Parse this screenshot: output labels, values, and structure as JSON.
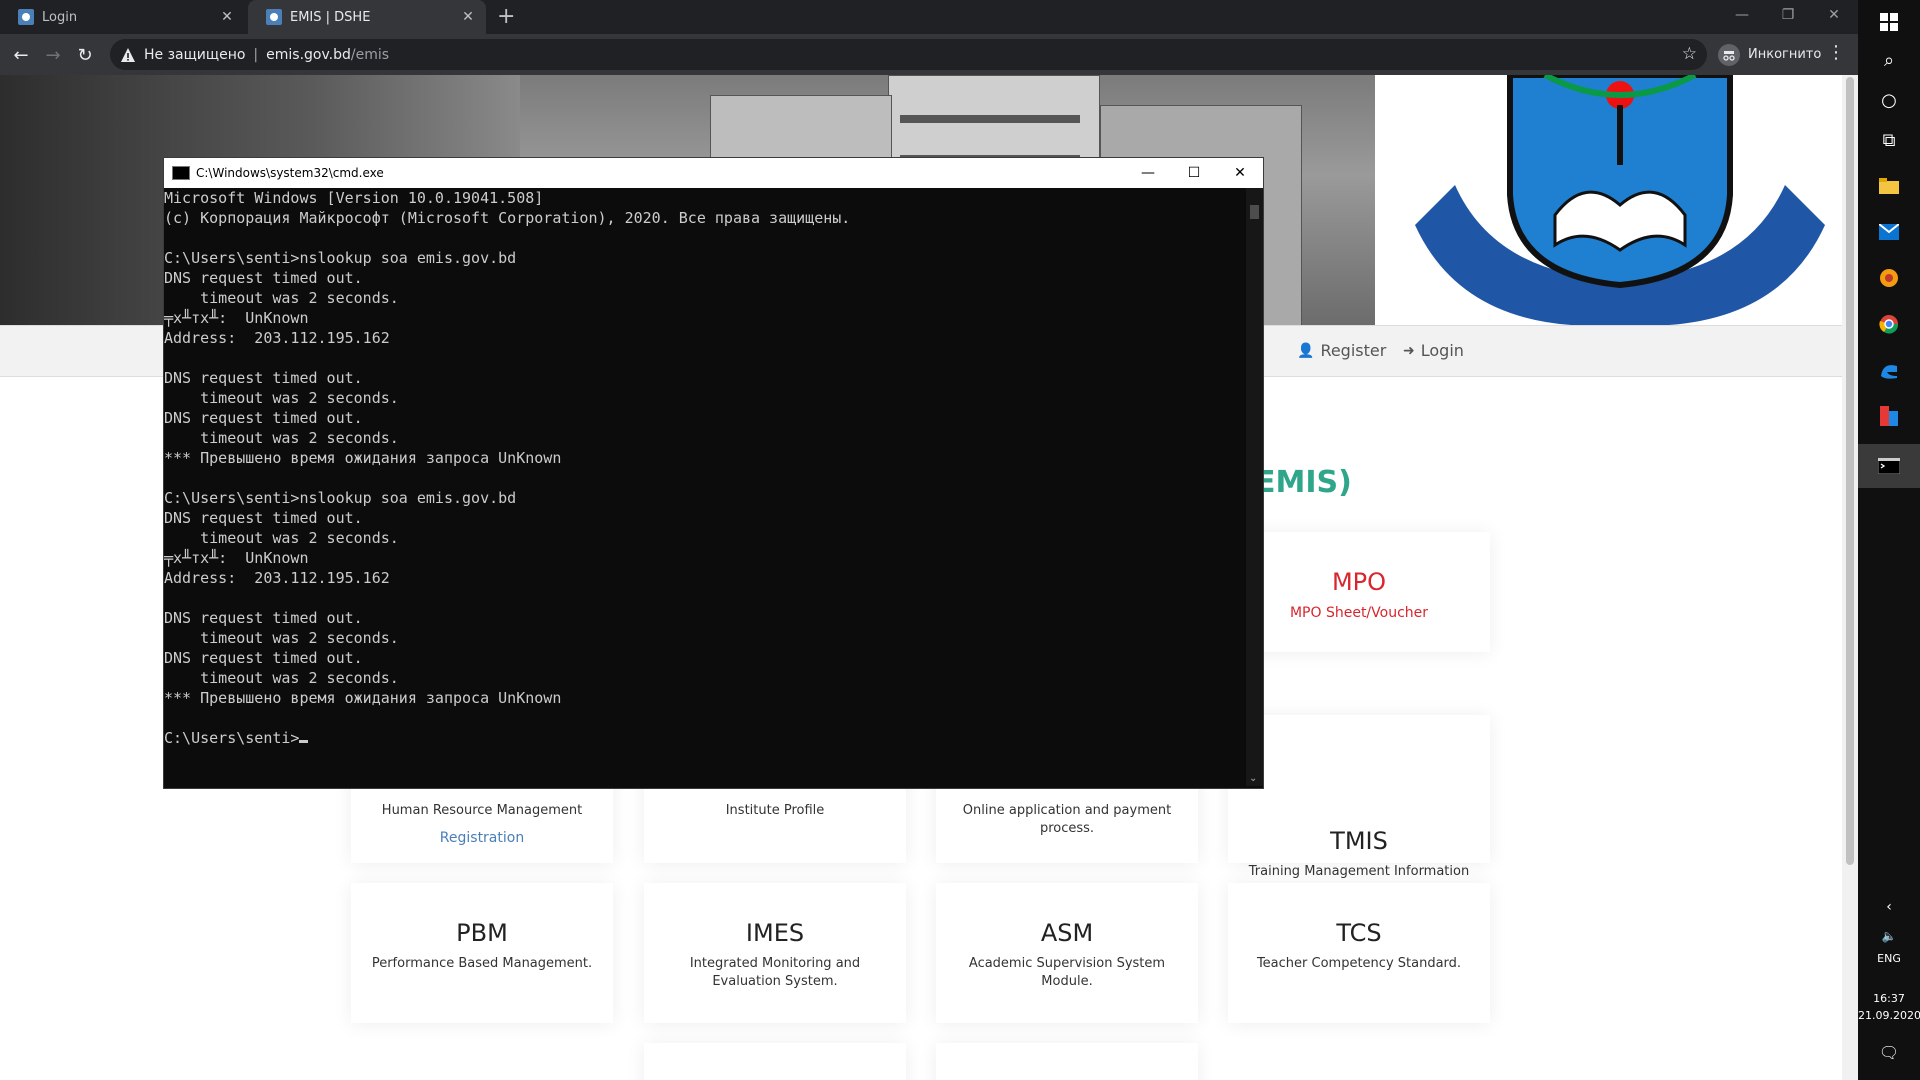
{
  "browser": {
    "tabs": [
      {
        "label": "Login",
        "active": false
      },
      {
        "label": "EMIS | DSHE",
        "active": true
      }
    ],
    "security_label": "Не защищено",
    "url_host": "emis.gov.bd",
    "url_path": "/emis",
    "profile_label": "Инкогнито"
  },
  "site": {
    "nav": {
      "register": "Register",
      "login": "Login"
    },
    "heading": "EMIS)",
    "cards": [
      {
        "title": "MPO",
        "desc": "MPO Sheet/Voucher",
        "link": ""
      },
      {
        "title": "",
        "desc": "Human Resource Management",
        "link": "Registration"
      },
      {
        "title": "",
        "desc": "Institute Profile",
        "link": ""
      },
      {
        "title": "",
        "desc": "Online application and payment process.",
        "link": ""
      },
      {
        "title": "TMIS",
        "desc": "Training Management Information System.",
        "link": ""
      },
      {
        "title": "PBM",
        "desc": "Performance Based Management.",
        "link": ""
      },
      {
        "title": "IMES",
        "desc": "Integrated Monitoring and Evaluation System.",
        "link": ""
      },
      {
        "title": "ASM",
        "desc": "Academic Supervision System Module.",
        "link": ""
      },
      {
        "title": "TCS",
        "desc": "Teacher Competency Standard.",
        "link": ""
      }
    ]
  },
  "cmd": {
    "title": "C:\\Windows\\system32\\cmd.exe",
    "output": "Microsoft Windows [Version 10.0.19041.508]\n(c) Корпорация Майкрософт (Microsoft Corporation), 2020. Все права защищены.\n\nC:\\Users\\senti>nslookup soa emis.gov.bd\nDNS request timed out.\n    timeout was 2 seconds.\n╤х╨тх╨:  UnKnown\nAddress:  203.112.195.162\n\nDNS request timed out.\n    timeout was 2 seconds.\nDNS request timed out.\n    timeout was 2 seconds.\n*** Превышено время ожидания запроса UnKnown\n\nC:\\Users\\senti>nslookup soa emis.gov.bd\nDNS request timed out.\n    timeout was 2 seconds.\n╤х╨тх╨:  UnKnown\nAddress:  203.112.195.162\n\nDNS request timed out.\n    timeout was 2 seconds.\nDNS request timed out.\n    timeout was 2 seconds.\n*** Превышено время ожидания запроса UnKnown\n\nC:\\Users\\senti>"
  },
  "taskbar": {
    "lang": "ENG",
    "time": "16:37",
    "date": "21.09.2020"
  },
  "colors": {
    "accent_green": "#2fa68a",
    "mpo_red": "#d9262e",
    "link_blue": "#4a7fb8"
  }
}
